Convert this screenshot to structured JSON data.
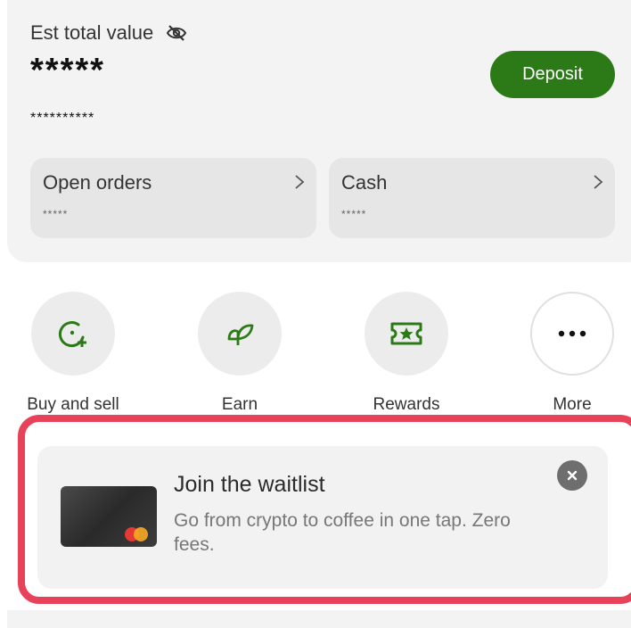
{
  "balance": {
    "label": "Est total value",
    "value_masked": "*****",
    "sub_value_masked": "**********",
    "deposit_label": "Deposit"
  },
  "tiles": [
    {
      "title": "Open orders",
      "value_masked": "*****"
    },
    {
      "title": "Cash",
      "value_masked": "*****"
    }
  ],
  "actions": [
    {
      "label": "Buy and sell",
      "icon": "buy-sell-icon"
    },
    {
      "label": "Earn",
      "icon": "leaf-icon"
    },
    {
      "label": "Rewards",
      "icon": "ticket-star-icon"
    },
    {
      "label": "More",
      "icon": "more-dots-icon"
    }
  ],
  "promo": {
    "title": "Join the waitlist",
    "body": "Go from crypto to coffee in one tap. Zero fees."
  },
  "colors": {
    "accent": "#2c7a17",
    "highlight": "#e8415a"
  }
}
